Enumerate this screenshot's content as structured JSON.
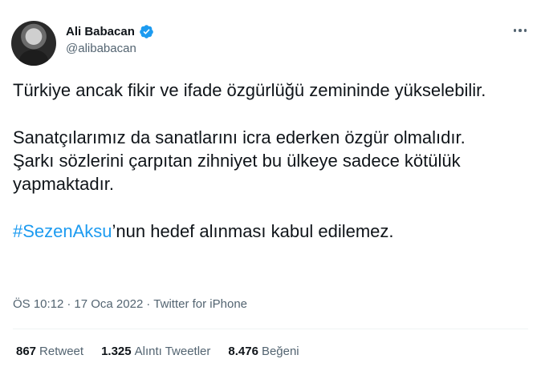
{
  "author": {
    "display_name": "Ali Babacan",
    "handle": "@alibabacan",
    "verified": true
  },
  "tweet": {
    "paragraph1": "Türkiye ancak fikir ve ifade özgürlüğü zemininde yükselebilir.",
    "paragraph2": "Sanatçılarımız da sanatlarını icra ederken özgür olmalıdır. Şarkı sözlerini çarpıtan zihniyet bu ülkeye sadece kötülük yapmaktadır.",
    "hashtag": "#SezenAksu",
    "paragraph3_rest": "’nun hedef alınması kabul edilemez."
  },
  "meta": {
    "time": "ÖS 10:12",
    "sep1": "·",
    "date": "17 Oca 2022",
    "sep2": "·",
    "source": "Twitter for iPhone"
  },
  "stats": {
    "retweets_count": "867",
    "retweets_label": "Retweet",
    "quotes_count": "1.325",
    "quotes_label": "Alıntı Tweetler",
    "likes_count": "8.476",
    "likes_label": "Beğeni"
  },
  "colors": {
    "accent": "#1d9bf0",
    "text": "#0f1419",
    "secondary": "#536471",
    "divider": "#eff3f4"
  },
  "icons": {
    "verified": "verified-badge-icon",
    "more": "more-options-icon"
  }
}
